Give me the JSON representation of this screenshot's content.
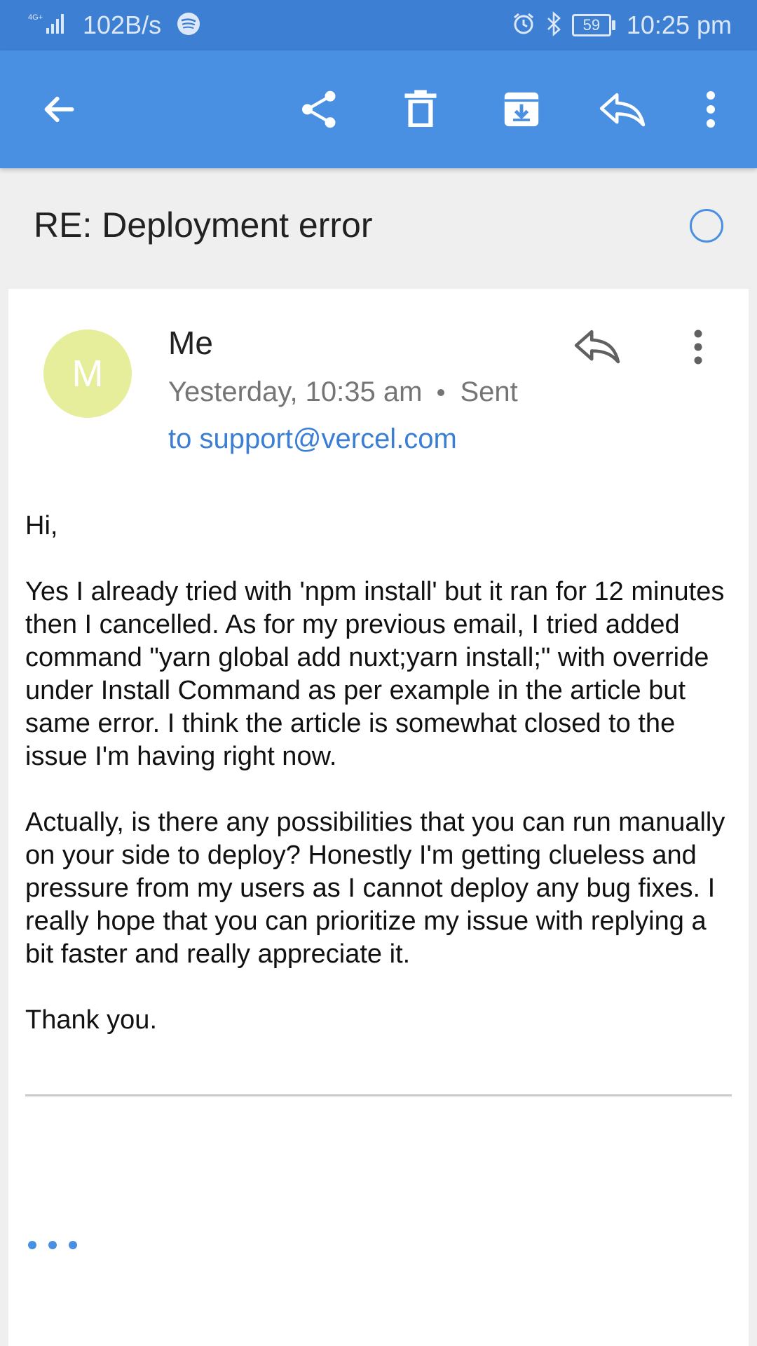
{
  "status_bar": {
    "network": "4G+",
    "speed": "102B/s",
    "battery": "59",
    "time": "10:25 pm"
  },
  "subject": "RE: Deployment error",
  "message": {
    "avatar_letter": "M",
    "avatar_color": "#e6ee9c",
    "sender": "Me",
    "date": "Yesterday, 10:35 am",
    "status": "Sent",
    "recipient": "to support@vercel.com",
    "body": [
      "Hi,",
      "Yes I already tried with 'npm install' but it ran for 12 minutes then I cancelled. As for my previous email, I tried added command \"yarn global add nuxt;yarn install;\" with override under Install Command as per example in the article but same error. I think the article is somewhat closed to the issue I'm having right now.",
      "Actually, is there any possibilities that you can run manually on your side to deploy? Honestly I'm getting clueless and pressure from my users as I cannot deploy any bug fixes. I really hope that you can prioritize my issue with replying a bit faster and really appreciate it.",
      "Thank you."
    ]
  },
  "colors": {
    "status_bar": "#3d7fd2",
    "app_bar": "#4a90e2",
    "link": "#3b7fd4"
  },
  "icons": [
    "back-arrow-icon",
    "share-icon",
    "delete-icon",
    "archive-icon",
    "reply-icon",
    "more-vert-icon",
    "star-circle-icon",
    "ellipsis-icon"
  ]
}
